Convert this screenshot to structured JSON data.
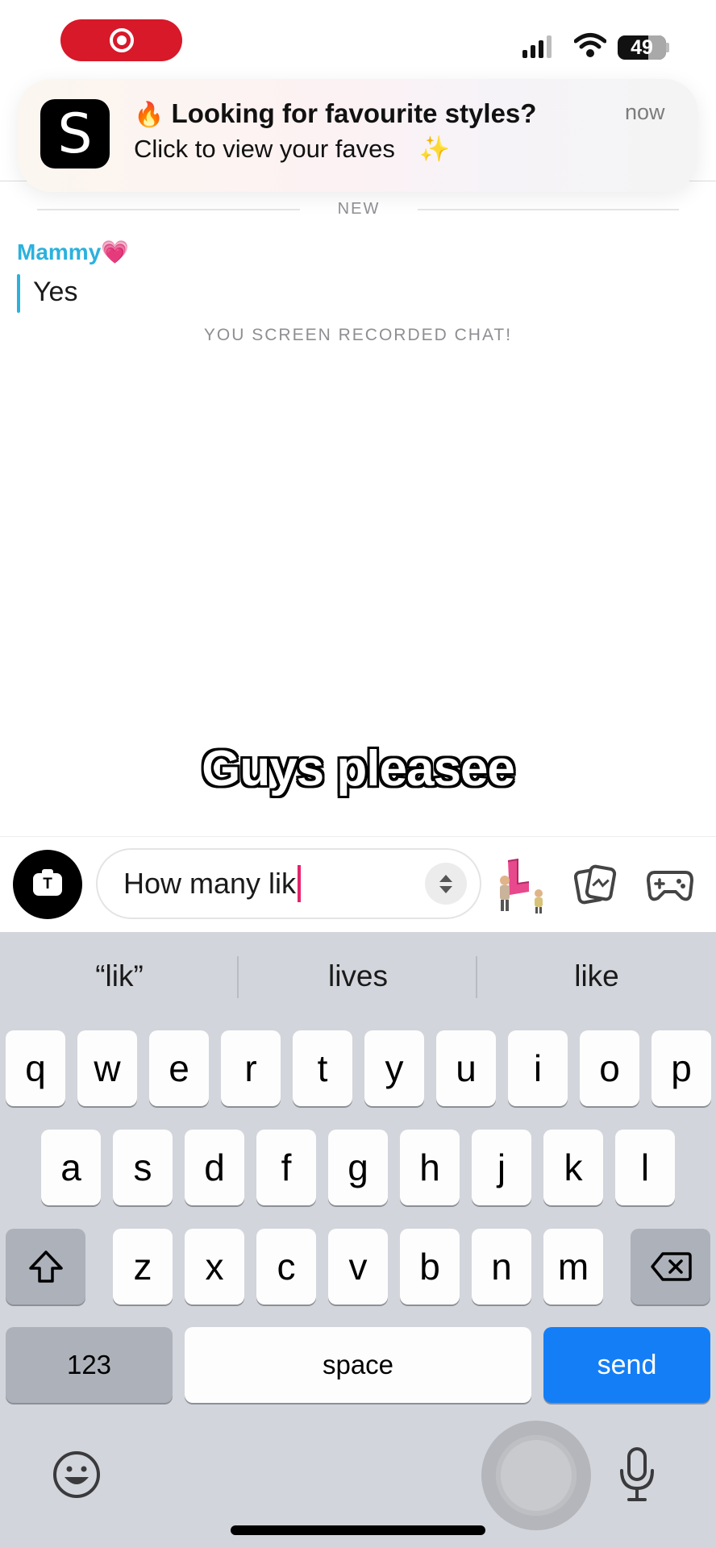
{
  "status_bar": {
    "battery": "49"
  },
  "notification": {
    "app_letter": "S",
    "emoji": "🔥",
    "title": "Looking for favourite styles?",
    "body": "Click to view your faves",
    "sparkle": "✨",
    "time": "now"
  },
  "chat": {
    "divider_label": "NEW",
    "sender": "Mammy",
    "sender_emoji": "💗",
    "message": "Yes",
    "system_notice": "YOU SCREEN RECORDED CHAT!"
  },
  "overlay_caption": "Guys pleasee",
  "composer": {
    "camera_glyph": "T",
    "text": "How many lik"
  },
  "keyboard": {
    "suggestions": [
      "“lik”",
      "lives",
      "like"
    ],
    "row1": [
      "q",
      "w",
      "e",
      "r",
      "t",
      "y",
      "u",
      "i",
      "o",
      "p"
    ],
    "row2": [
      "a",
      "s",
      "d",
      "f",
      "g",
      "h",
      "j",
      "k",
      "l"
    ],
    "row3": [
      "z",
      "x",
      "c",
      "v",
      "b",
      "n",
      "m"
    ],
    "numbers_label": "123",
    "space_label": "space",
    "send_label": "send"
  },
  "colors": {
    "accent_blue": "#137ef6",
    "sender_color": "#2cb1dd",
    "caret": "#e4236b",
    "record_pill": "#d7192a"
  },
  "icons": [
    "record-icon",
    "signal-icon",
    "wifi-icon",
    "battery-icon",
    "camera-icon",
    "stepper-icon",
    "bitmoji-icon",
    "sticker-icon",
    "game-controller-icon",
    "shift-icon",
    "backspace-icon",
    "emoji-icon",
    "microphone-icon"
  ]
}
